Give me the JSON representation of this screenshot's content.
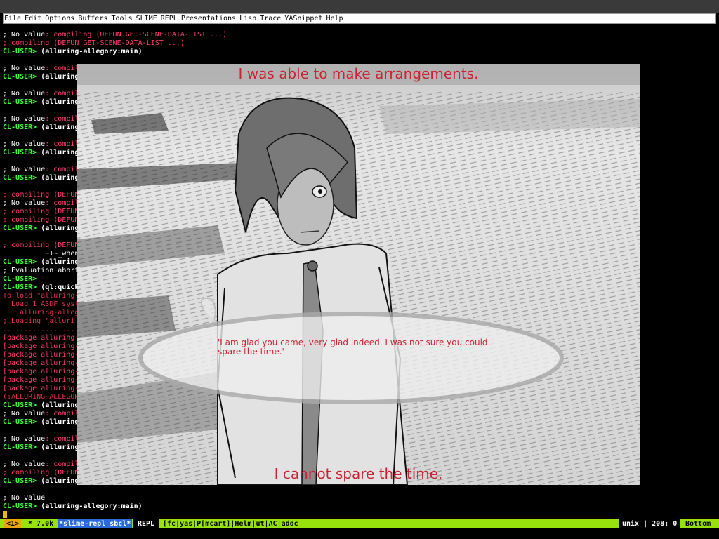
{
  "menu": [
    "File",
    "Edit",
    "Options",
    "Buffers",
    "Tools",
    "SLIME",
    "REPL",
    "Presentations",
    "Lisp",
    "Trace",
    "YASnippet",
    "Help"
  ],
  "terminal_lines": [
    [
      {
        "t": "; No value",
        "c": "c-white"
      },
      {
        "t": ": compiling (DEFUN GET-SCENE-DATA-LIST ...)",
        "c": "c-red"
      }
    ],
    [
      {
        "t": "; compiling (DEFUN GET-SCENE-DATA-LIST ...)",
        "c": "c-red"
      }
    ],
    [
      {
        "t": "CL-USER> ",
        "c": "c-prompt"
      },
      {
        "t": "(alluring-allegory:main)",
        "c": "c-cmd"
      }
    ],
    [],
    [
      {
        "t": "; No value",
        "c": "c-white"
      },
      {
        "t": ": compil",
        "c": "c-red"
      }
    ],
    [
      {
        "t": "CL-USER> ",
        "c": "c-prompt"
      },
      {
        "t": "(alluring",
        "c": "c-cmd"
      }
    ],
    [],
    [
      {
        "t": "; No value",
        "c": "c-white"
      },
      {
        "t": ": compil",
        "c": "c-red"
      }
    ],
    [
      {
        "t": "CL-USER> ",
        "c": "c-prompt"
      },
      {
        "t": "(alluring",
        "c": "c-cmd"
      }
    ],
    [],
    [
      {
        "t": "; No value",
        "c": "c-white"
      },
      {
        "t": ": compil",
        "c": "c-red"
      }
    ],
    [
      {
        "t": "CL-USER> ",
        "c": "c-prompt"
      },
      {
        "t": "(alluring",
        "c": "c-cmd"
      }
    ],
    [],
    [
      {
        "t": "; No value",
        "c": "c-white"
      },
      {
        "t": ": compil",
        "c": "c-red"
      }
    ],
    [
      {
        "t": "CL-USER> ",
        "c": "c-prompt"
      },
      {
        "t": "(alluring",
        "c": "c-cmd"
      }
    ],
    [],
    [
      {
        "t": "; No value",
        "c": "c-white"
      },
      {
        "t": ": compil",
        "c": "c-red"
      }
    ],
    [
      {
        "t": "CL-USER> ",
        "c": "c-prompt"
      },
      {
        "t": "(alluring",
        "c": "c-cmd"
      }
    ],
    [],
    [
      {
        "t": "; compiling (DEFUN",
        "c": "c-red"
      }
    ],
    [
      {
        "t": "; No value",
        "c": "c-white"
      },
      {
        "t": ": compil",
        "c": "c-red"
      }
    ],
    [
      {
        "t": "; compiling (DEFUN",
        "c": "c-red"
      }
    ],
    [
      {
        "t": "; compiling (DEFUN",
        "c": "c-red"
      }
    ],
    [
      {
        "t": "CL-USER> ",
        "c": "c-prompt"
      },
      {
        "t": "(alluring",
        "c": "c-cmd"
      }
    ],
    [],
    [
      {
        "t": "; compiling (DEFUN",
        "c": "c-red"
      }
    ],
    [
      {
        "t": "          ~I~_when",
        "c": "c-white"
      }
    ],
    [
      {
        "t": "CL-USER> ",
        "c": "c-prompt"
      },
      {
        "t": "(alluring",
        "c": "c-cmd"
      }
    ],
    [
      {
        "t": "; Evaluation abort",
        "c": "c-white"
      }
    ],
    [
      {
        "t": "CL-USER>",
        "c": "c-prompt"
      }
    ],
    [
      {
        "t": "CL-USER> ",
        "c": "c-prompt"
      },
      {
        "t": "(ql:quick",
        "c": "c-cmd"
      }
    ],
    [
      {
        "t": "To load \"alluring-",
        "c": "c-dred"
      }
    ],
    [
      {
        "t": "  Load 1 ASDF syst",
        "c": "c-dred"
      }
    ],
    [
      {
        "t": "    alluring-alleg",
        "c": "c-dred"
      }
    ],
    [
      {
        "t": "; Loading \"alluri",
        "c": "c-dred"
      }
    ],
    [
      {
        "t": "..................",
        "c": "c-dred"
      }
    ],
    [
      {
        "t": "[package alluring-",
        "c": "c-red"
      }
    ],
    [
      {
        "t": "[package alluring-",
        "c": "c-red"
      }
    ],
    [
      {
        "t": "[package alluring-",
        "c": "c-red"
      }
    ],
    [
      {
        "t": "[package alluring-",
        "c": "c-red"
      }
    ],
    [
      {
        "t": "[package alluring-",
        "c": "c-red"
      }
    ],
    [
      {
        "t": "[package alluring-",
        "c": "c-red"
      }
    ],
    [
      {
        "t": "[package alluring-",
        "c": "c-red"
      }
    ],
    [
      {
        "t": "(:ALLURING-ALLEGOR",
        "c": "c-dred"
      }
    ],
    [
      {
        "t": "CL-USER> ",
        "c": "c-prompt"
      },
      {
        "t": "(alluring",
        "c": "c-cmd"
      }
    ],
    [
      {
        "t": "; No value",
        "c": "c-white"
      },
      {
        "t": ": compil",
        "c": "c-red"
      }
    ],
    [
      {
        "t": "CL-USER> ",
        "c": "c-prompt"
      },
      {
        "t": "(alluring",
        "c": "c-cmd"
      }
    ],
    [],
    [
      {
        "t": "; No value",
        "c": "c-white"
      },
      {
        "t": ": compil",
        "c": "c-red"
      }
    ],
    [
      {
        "t": "CL-USER> ",
        "c": "c-prompt"
      },
      {
        "t": "(alluring",
        "c": "c-cmd"
      }
    ],
    [],
    [
      {
        "t": "; No value",
        "c": "c-white"
      },
      {
        "t": ": compil",
        "c": "c-red"
      }
    ],
    [
      {
        "t": "; compiling (DEFUN",
        "c": "c-red"
      }
    ],
    [
      {
        "t": "CL-USER> ",
        "c": "c-prompt"
      },
      {
        "t": "(alluring",
        "c": "c-cmd"
      }
    ],
    [],
    [
      {
        "t": "; No value",
        "c": "c-white"
      }
    ],
    [
      {
        "t": "CL-USER> ",
        "c": "c-prompt"
      },
      {
        "t": "(alluring-allegory:main)",
        "c": "c-cmd"
      }
    ]
  ],
  "game": {
    "narration": "I was able to make arrangements.",
    "dialogue": "'I am glad you came, very glad indeed.  I was not sure you could spare the time.'",
    "choice": "I cannot spare the time."
  },
  "modeline": {
    "indicator": "<1>",
    "size": "* 7.0k",
    "buffer": "*slime-repl sbcl*",
    "mode": "REPL",
    "minor_modes": "[fc|yas|P[mcart]|Helm|ut|AC|adoc",
    "encoding": "unix | 208: 0",
    "position": "Bottom"
  },
  "colors": {
    "prompt": "#3cff3c",
    "compile_text": "#ff3a6a",
    "modeline_bg": "#97e20c",
    "game_text": "#cc2233"
  }
}
